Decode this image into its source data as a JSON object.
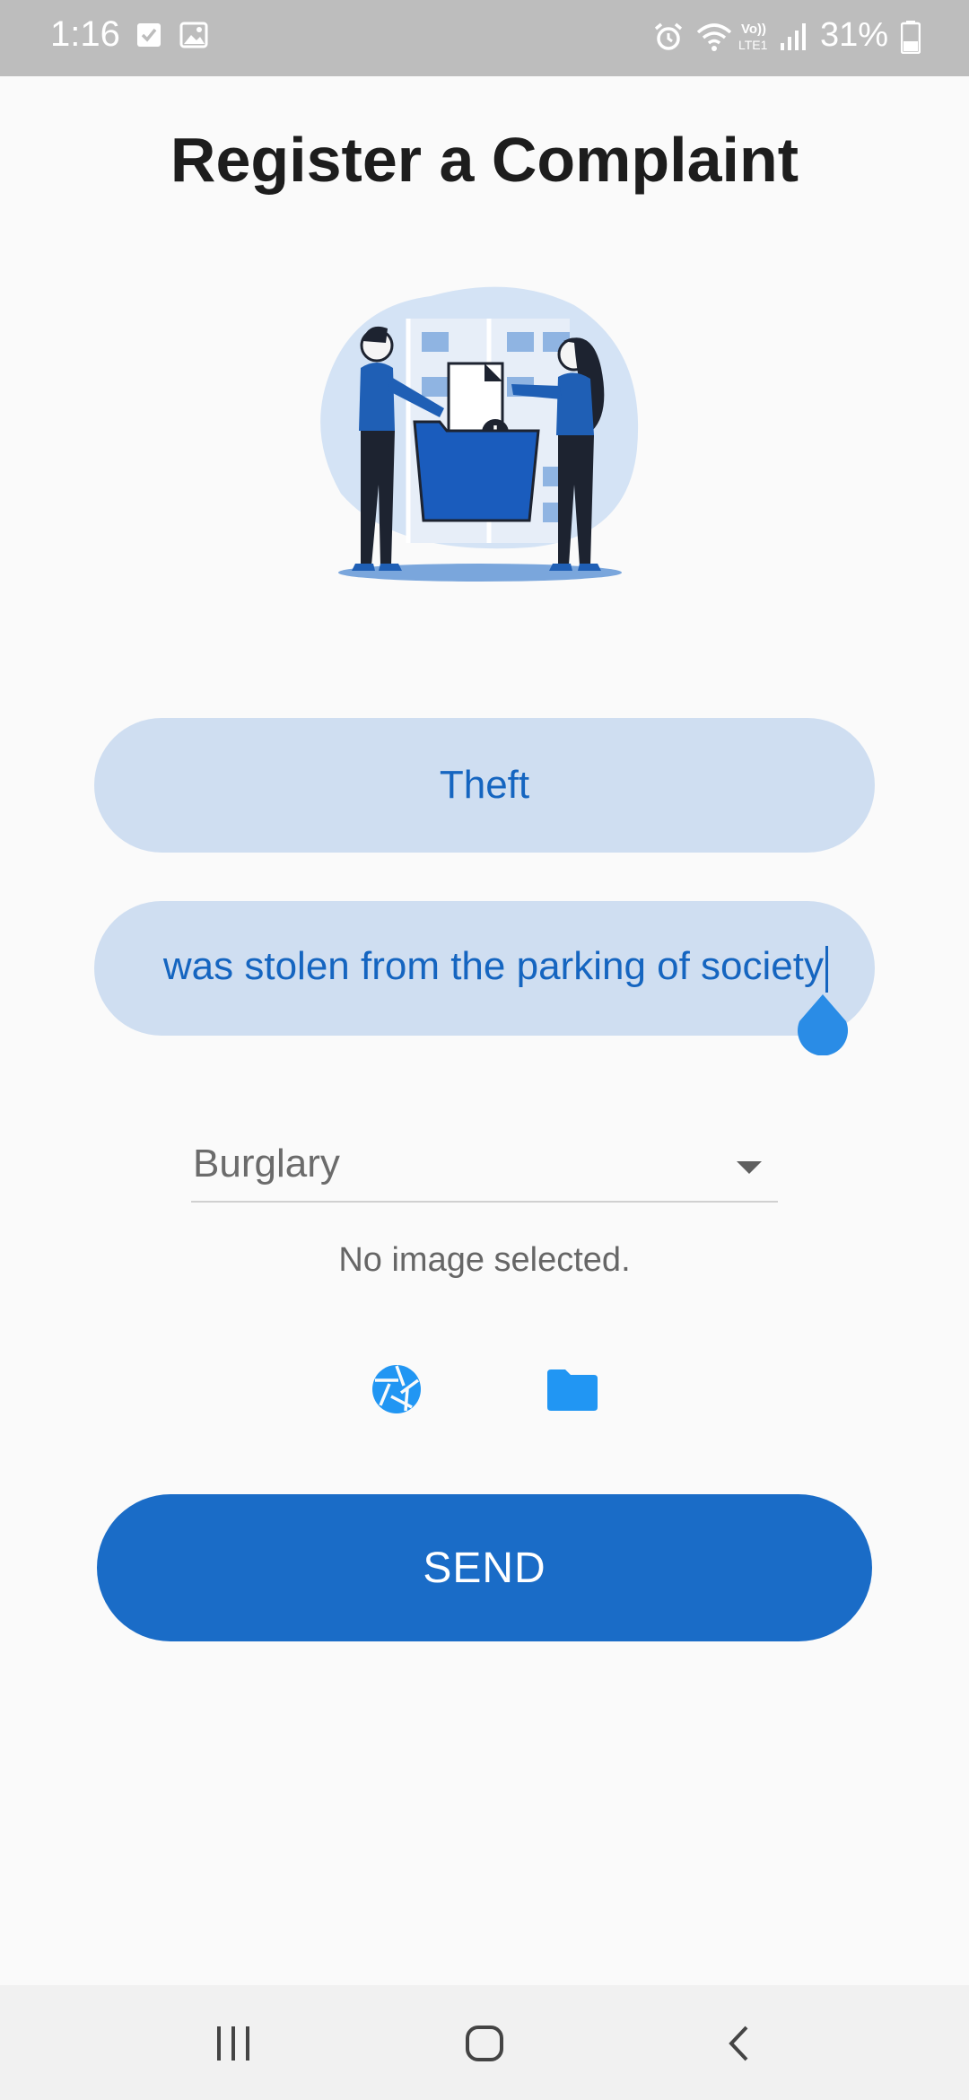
{
  "status_bar": {
    "time": "1:16",
    "battery": "31%",
    "icons": [
      "checkbox-notification-icon",
      "gallery-notification-icon",
      "alarm-icon",
      "wifi-icon",
      "volte-lte-icon",
      "signal-icon",
      "battery-icon"
    ]
  },
  "page": {
    "title": "Register a Complaint"
  },
  "form": {
    "complaint_title_value": "Theft",
    "description_value": "was stolen from the parking of society",
    "category_selected": "Burglary",
    "image_status": "No image selected.",
    "send_label": "SEND"
  },
  "icons": {
    "camera": "camera-aperture-icon",
    "folder": "folder-icon"
  },
  "colors": {
    "accent": "#1a6cc7",
    "input_bg": "#cfdef1",
    "input_text": "#1565c0",
    "icon_blue": "#2196f3"
  },
  "nav_bar": {
    "buttons": [
      "recent-apps",
      "home",
      "back"
    ]
  }
}
